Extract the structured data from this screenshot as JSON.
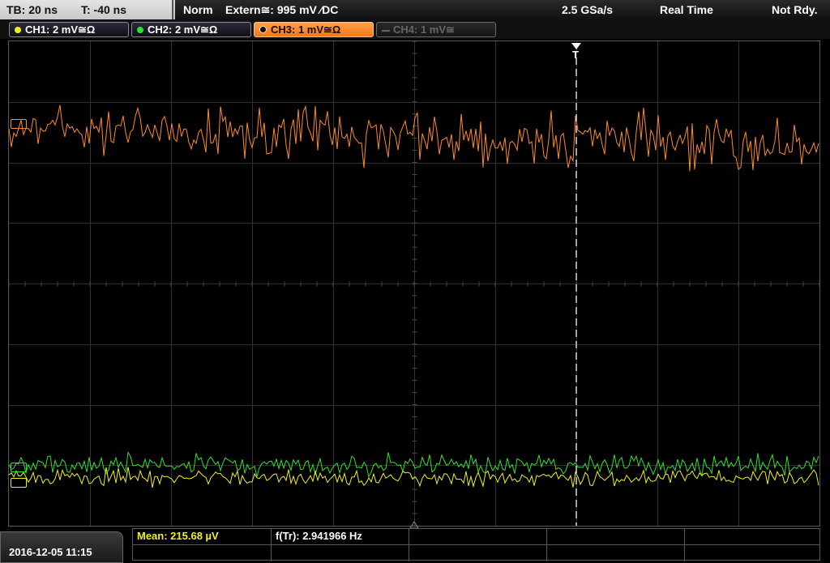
{
  "status_bar": {
    "timebase": "TB: 20 ns",
    "trigger_time": "T: -40 ns",
    "mode": "Norm",
    "trigger_source": "Extern≅: 995 mV ⁄DC",
    "sample_rate": "2.5 GSa/s",
    "acq_mode": "Real Time",
    "state": "Not Rdy."
  },
  "channels": [
    {
      "label": "CH1: 2 mV≅Ω",
      "color": "#f0f020",
      "active": false
    },
    {
      "label": "CH2: 2 mV≅Ω",
      "color": "#30e030",
      "active": false
    },
    {
      "label": "CH3: 1 mV≅Ω",
      "color": "#ff8a2a",
      "active": true
    },
    {
      "label": "CH4: 1 mV≅",
      "color": "#666666",
      "active": false
    }
  ],
  "measurements": {
    "mean": "Mean: 215.68 µV",
    "frequency": "f(Tr): 2.941966 Hz"
  },
  "datetime": "2016-12-05 11:15",
  "trigger_marker_label": "T",
  "colors": {
    "ch1": "#f0f020",
    "ch2": "#30e030",
    "ch3": "#ff8a2a",
    "grid": "#2f2f2f",
    "mean_text": "#f0f020"
  },
  "icons": {
    "trigger-position": "down-triangle",
    "ground-marker": "up-triangle"
  }
}
